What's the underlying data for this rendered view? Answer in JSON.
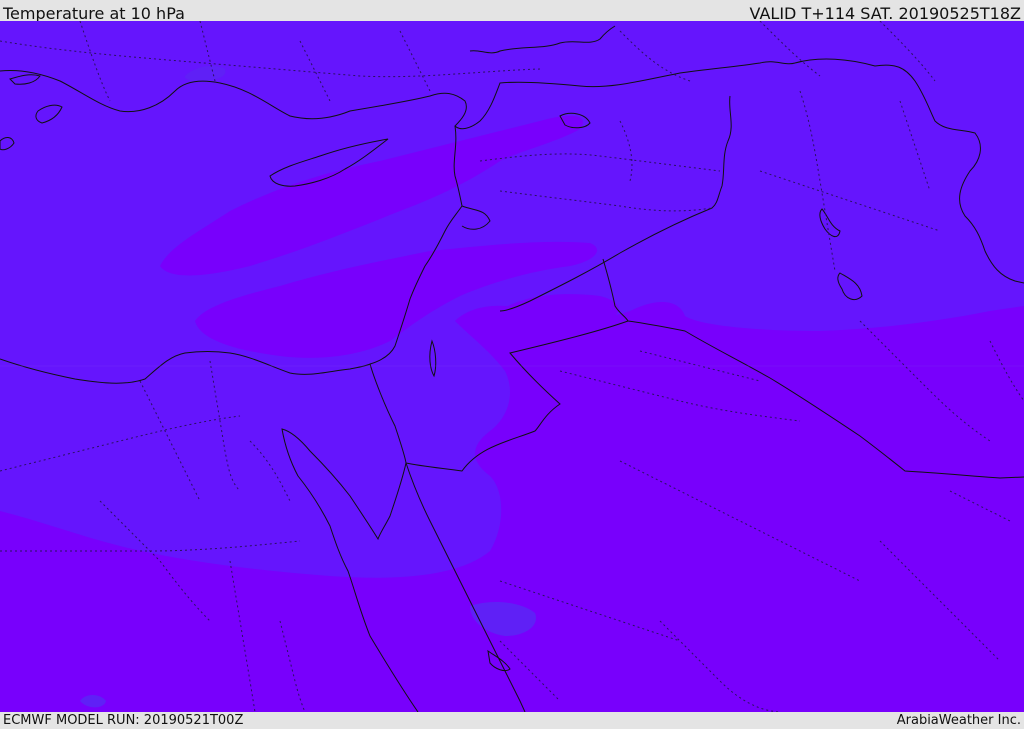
{
  "header": {
    "title": "Temperature at 10 hPa",
    "valid_time": "VALID T+114 SAT. 20190525T18Z"
  },
  "footer": {
    "model_run": "ECMWF MODEL RUN: 20190521T00Z",
    "credit": "ArabiaWeather Inc."
  },
  "map": {
    "colors": {
      "field_cool": "#6515fd",
      "field_warm": "#7800fc",
      "field_cold_patch": "#5b28f4",
      "border": "#111111",
      "admin_border": "#2a1060"
    }
  }
}
